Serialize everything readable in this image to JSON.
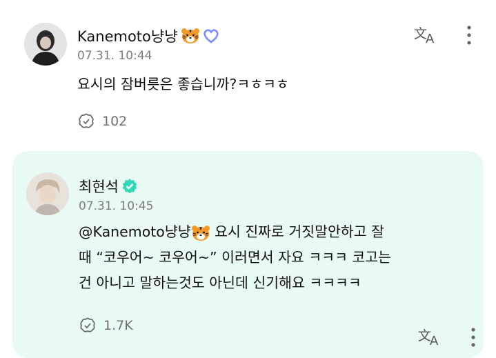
{
  "posts": [
    {
      "author": "Kanemoto냥냥",
      "time": "07.31. 10:44",
      "text_lines": [
        "요시의 잠버릇은 좋습니까?ㅋㅎㅋㅎ"
      ],
      "reaction_count": "102",
      "verified": false,
      "highlighted": false
    },
    {
      "author": "최현석",
      "time": "07.31. 10:45",
      "mention": "@Kanemoto냥냥",
      "text_lines": [
        " 요시 진짜로 거짓말안하고 잘",
        "때 “코우어~ 코우어~” 이러면서 자요 ㅋㅋㅋ 코고는",
        "건 아니고 말하는것도 아닌데 신기해요 ㅋㅋㅋㅋ"
      ],
      "reaction_count": "1.7K",
      "verified": true,
      "highlighted": true
    }
  ],
  "icons": {
    "translate": "translate-icon",
    "more": "more-vertical-icon",
    "reaction": "reaction-icon",
    "tiger": "tiger-emoji",
    "heart_badge": "heart-badge-icon",
    "verified": "verified-badge-icon"
  },
  "colors": {
    "highlight_bg": "#e8faf3",
    "verified": "#2fd9b6",
    "heart_badge": "#7a8cff"
  }
}
